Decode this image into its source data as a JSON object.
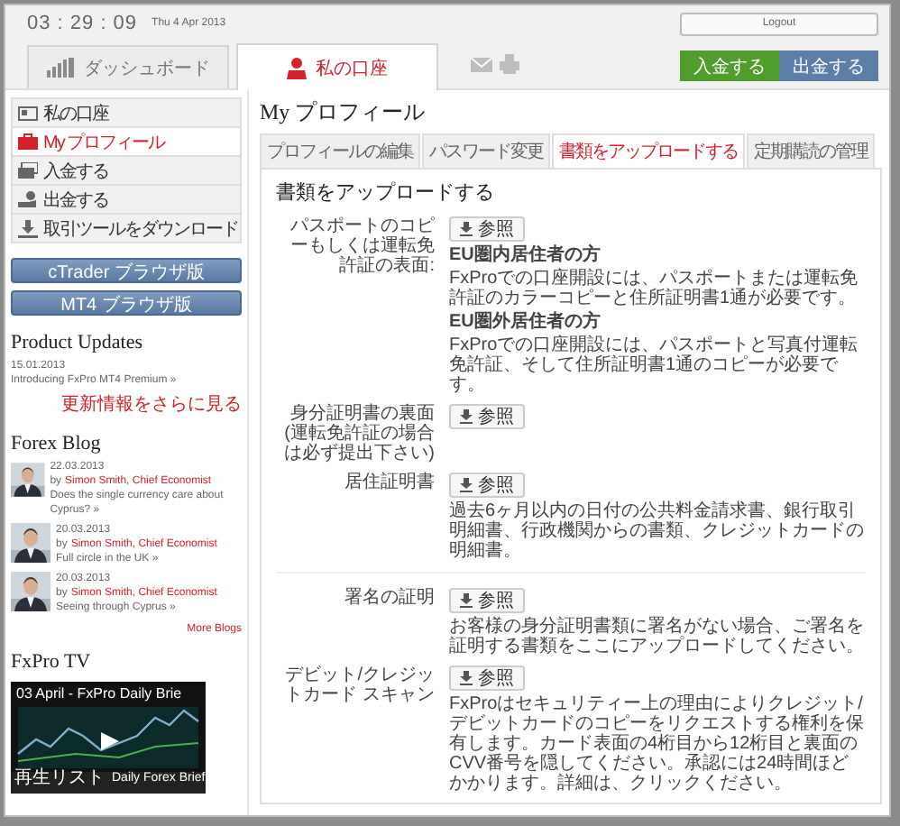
{
  "header": {
    "clock": "03 : 29 : 09",
    "date": "Thu 4 Apr 2013",
    "logout": "Logout"
  },
  "main_tabs": [
    {
      "label": "ダッシュボード",
      "selected": false
    },
    {
      "label": "私の口座",
      "selected": true
    }
  ],
  "actions": [
    {
      "label": "入金する",
      "color": "#4f9d2c"
    },
    {
      "label": "出金する",
      "color": "#5b7fa8"
    }
  ],
  "sidebar": {
    "menu": [
      {
        "label": "私の口座",
        "selected": false
      },
      {
        "label": "My プロフィール",
        "selected": true
      },
      {
        "label": "入金する",
        "selected": false
      },
      {
        "label": "出金する",
        "selected": false
      },
      {
        "label": "取引ツールをダウンロード",
        "selected": false
      }
    ],
    "platform_buttons": [
      "cTrader ブラウザ版",
      "MT4 ブラウザ版"
    ],
    "product_updates": {
      "title": "Product Updates",
      "items": [
        {
          "date": "15.01.2013",
          "text": "Introducing FxPro MT4 Premium »"
        }
      ],
      "more": "更新情報をさらに見る"
    },
    "blog": {
      "title": "Forex Blog",
      "posts": [
        {
          "date": "22.03.2013",
          "by": "by",
          "author": "Simon Smith, Chief Economist",
          "text": "Does the single currency care about Cyprus? »"
        },
        {
          "date": "20.03.2013",
          "by": "by",
          "author": "Simon Smith, Chief Economist",
          "text": "Full circle in the UK »"
        },
        {
          "date": "20.03.2013",
          "by": "by",
          "author": "Simon Smith, Chief Economist",
          "text": "Seeing through Cyprus »"
        }
      ],
      "more": "More Blogs"
    },
    "tv": {
      "title": "FxPro TV",
      "video_title": "03 April - FxPro Daily Brie",
      "playlist": "再生リスト",
      "episode": "Daily Forex Brief"
    }
  },
  "profile": {
    "title": "My プロフィール",
    "tabs": [
      {
        "label": "プロフィールの編集",
        "selected": false
      },
      {
        "label": "パスワード変更",
        "selected": false
      },
      {
        "label": "書類をアップロードする",
        "selected": true
      },
      {
        "label": "定期購読の管理",
        "selected": false
      }
    ],
    "panel_title": "書類をアップロードする",
    "sections": [
      {
        "rows": [
          {
            "label": "パスポートのコピーもしくは運転免許証の表面:",
            "button": "参照",
            "paragraphs": [
              {
                "kind": "heading",
                "text": "EU圏内居住者の方"
              },
              {
                "kind": "text",
                "text": "FxProでの口座開設には、パスポートまたは運転免許証のカラーコピーと住所証明書1通が必要です。"
              },
              {
                "kind": "heading",
                "text": "EU圏外居住者の方"
              },
              {
                "kind": "text",
                "text": "FxProでの口座開設には、パスポートと写真付運転免許証、そして住所証明書1通のコピーが必要です。"
              }
            ]
          },
          {
            "label": "身分証明書の裏面(運転免許証の場合は必ず提出下さい)",
            "button": "参照",
            "paragraphs": []
          },
          {
            "label": "居住証明書",
            "button": "参照",
            "paragraphs": [
              {
                "text": "過去6ヶ月以内の日付の公共料金請求書、銀行取引明細書、行政機関からの書類、クレジットカードの明細書。",
                "kind": "text"
              }
            ]
          }
        ]
      },
      {
        "rows": [
          {
            "label": "署名の証明",
            "button": "参照",
            "paragraphs": [
              {
                "text": "お客様の身分証明書類に署名がない場合、ご署名を証明する書類をここにアップロードしてください。",
                "kind": "text"
              }
            ]
          },
          {
            "label": "デビット/クレジットカード スキャン",
            "button": "参照",
            "paragraphs": [
              {
                "text": "FxProはセキュリティー上の理由によりクレジット/デビットカードのコピーをリクエストする権利を保有します。カード表面の4桁目から12桁目と裏面のCVV番号を隠してください。承認には24時間ほどかかります。詳細は、クリックください。",
                "kind": "text"
              }
            ]
          }
        ]
      }
    ]
  }
}
